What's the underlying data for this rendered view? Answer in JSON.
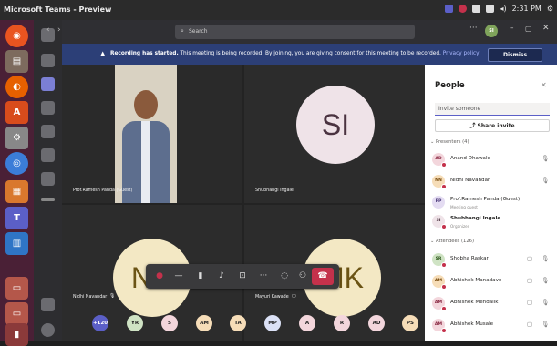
{
  "os": {
    "window_title": "Microsoft Teams - Preview",
    "clock": "2:31 PM"
  },
  "search": {
    "placeholder": "Search"
  },
  "banner": {
    "bold": "Recording has started.",
    "text": "This meeting is being recorded. By joining, you are giving consent for this meeting to be recorded.",
    "link": "Privacy policy",
    "dismiss": "Dismiss"
  },
  "tiles": {
    "ramesh": {
      "name": "Prof.Ramesh Panda (Guest)"
    },
    "shubhangi": {
      "initials": "SI",
      "name": "Shubhangi Ingale"
    },
    "nidhi": {
      "initials": "NN",
      "name": "Nidhi Navandar"
    },
    "mayuri": {
      "initials": "MK",
      "name": "Mayuri Kawade"
    }
  },
  "bottom_avatars": [
    "+120",
    "YR",
    "S",
    "AM",
    "TA",
    "MP",
    "A",
    "R",
    "AD",
    "PS"
  ],
  "people": {
    "title": "People",
    "invite_placeholder": "Invite someone",
    "share_invite": "Share invite",
    "presenters_label": "Presenters (4)",
    "presenters": [
      {
        "initials": "AD",
        "name": "Anand Dhawale",
        "sub": ""
      },
      {
        "initials": "NN",
        "name": "Nidhi Navandar",
        "sub": ""
      },
      {
        "initials": "PP",
        "name": "Prof.Ramesh Panda (Guest)",
        "sub": "Meeting guest"
      },
      {
        "initials": "SI",
        "name": "Shubhangi Ingale",
        "sub": "Organizer"
      }
    ],
    "attendees_label": "Attendees (126)",
    "attendees": [
      {
        "initials": "SR",
        "name": "Shobha Raskar"
      },
      {
        "initials": "AM",
        "name": "Abhishek Manadave"
      },
      {
        "initials": "AM",
        "name": "Abhishek Mendalik"
      },
      {
        "initials": "AM",
        "name": "Abhishek Musale"
      }
    ]
  },
  "colors": {
    "banner": "#2c3f77",
    "hangup": "#c4314b",
    "avatar_cream": "#f3e8c4",
    "teams_purple": "#5b5fc7"
  }
}
